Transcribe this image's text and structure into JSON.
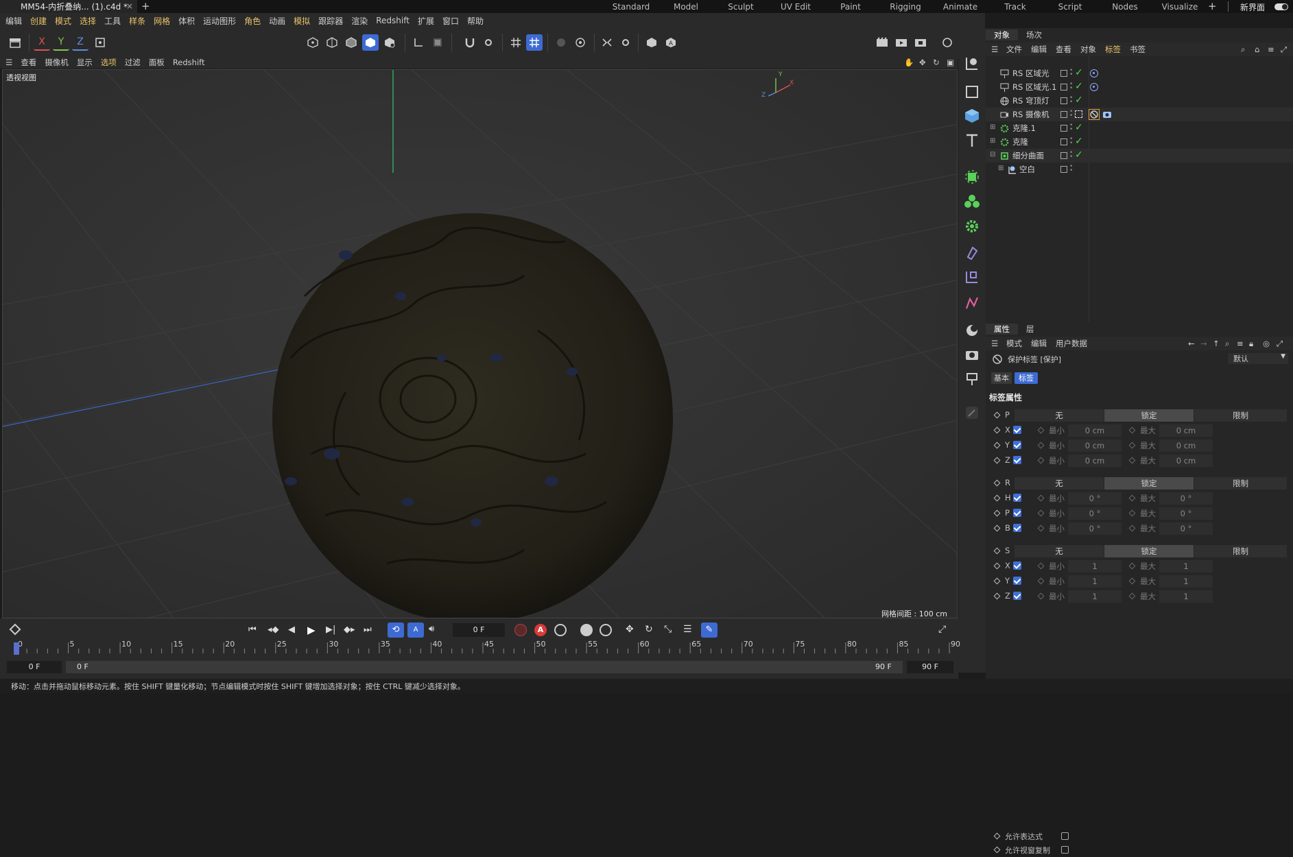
{
  "tab": {
    "title": "MM54-内折叠纳... (1).c4d *"
  },
  "layouts": [
    "Standard",
    "Model",
    "Sculpt",
    "UV Edit",
    "Paint",
    "Rigging",
    "Animate",
    "Track",
    "Script",
    "Nodes",
    "Visualize"
  ],
  "new_interface": "新界面",
  "menu": [
    {
      "label": "编辑",
      "hl": false
    },
    {
      "label": "创建",
      "hl": true
    },
    {
      "label": "模式",
      "hl": true
    },
    {
      "label": "选择",
      "hl": true
    },
    {
      "label": "工具",
      "hl": false
    },
    {
      "label": "样条",
      "hl": true
    },
    {
      "label": "网格",
      "hl": true
    },
    {
      "label": "体积",
      "hl": false
    },
    {
      "label": "运动图形",
      "hl": false
    },
    {
      "label": "角色",
      "hl": true
    },
    {
      "label": "动画",
      "hl": false
    },
    {
      "label": "模拟",
      "hl": true
    },
    {
      "label": "跟踪器",
      "hl": false
    },
    {
      "label": "渲染",
      "hl": false
    },
    {
      "label": "Redshift",
      "hl": false
    },
    {
      "label": "扩展",
      "hl": false
    },
    {
      "label": "窗口",
      "hl": false
    },
    {
      "label": "帮助",
      "hl": false
    }
  ],
  "toolbar": {
    "x": "X",
    "y": "Y",
    "z": "Z"
  },
  "viewport": {
    "menu": [
      {
        "label": "查看",
        "hl": false
      },
      {
        "label": "摄像机",
        "hl": false
      },
      {
        "label": "显示",
        "hl": false
      },
      {
        "label": "选项",
        "hl": true
      },
      {
        "label": "过滤",
        "hl": false
      },
      {
        "label": "面板",
        "hl": false
      },
      {
        "label": "Redshift",
        "hl": false
      }
    ],
    "label": "透视视图",
    "grid_spacing": "网格间距 : 100 cm",
    "axis": {
      "x": "X",
      "y": "Y",
      "z": "Z"
    }
  },
  "objects": {
    "tabs": [
      "对象",
      "场次"
    ],
    "menu": [
      {
        "label": "文件",
        "hl": false
      },
      {
        "label": "编辑",
        "hl": false
      },
      {
        "label": "查看",
        "hl": false
      },
      {
        "label": "对象",
        "hl": false
      },
      {
        "label": "标签",
        "hl": true
      },
      {
        "label": "书签",
        "hl": false
      }
    ],
    "rows": [
      {
        "name": "RS 区域光",
        "icon": "area-light-icon",
        "check": true,
        "tag": "target"
      },
      {
        "name": "RS 区域光.1",
        "icon": "area-light-icon",
        "check": true,
        "tag": "target"
      },
      {
        "name": "RS 穹顶灯",
        "icon": "dome-light-icon",
        "check": true,
        "tag": ""
      },
      {
        "name": "RS 摄像机",
        "icon": "camera-icon",
        "check": false,
        "tag": "protect-camera"
      },
      {
        "name": "克隆.1",
        "icon": "cloner-icon",
        "check": true,
        "tag": ""
      },
      {
        "name": "克隆",
        "icon": "cloner-icon",
        "check": true,
        "tag": ""
      },
      {
        "name": "细分曲面",
        "icon": "subdivision-icon",
        "check": true,
        "tag": ""
      },
      {
        "name": "空白",
        "icon": "null-icon",
        "check": false,
        "tag": ""
      }
    ]
  },
  "attributes": {
    "tabs": [
      "属性",
      "层"
    ],
    "menu": [
      "模式",
      "编辑",
      "用户数据"
    ],
    "tag_title": "保护标签 [保护]",
    "preset": "默认",
    "subtabs": [
      "基本",
      "标签"
    ],
    "section": "标签属性",
    "groups": [
      {
        "key": "P",
        "none": "无",
        "lock": "锁定",
        "limit": "限制",
        "axes": [
          {
            "a": "X",
            "min": "最小",
            "minv": "0 cm",
            "max": "最大",
            "maxv": "0 cm"
          },
          {
            "a": "Y",
            "min": "最小",
            "minv": "0 cm",
            "max": "最大",
            "maxv": "0 cm"
          },
          {
            "a": "Z",
            "min": "最小",
            "minv": "0 cm",
            "max": "最大",
            "maxv": "0 cm"
          }
        ]
      },
      {
        "key": "R",
        "none": "无",
        "lock": "锁定",
        "limit": "限制",
        "axes": [
          {
            "a": "H",
            "min": "最小",
            "minv": "0 °",
            "max": "最大",
            "maxv": "0 °"
          },
          {
            "a": "P",
            "min": "最小",
            "minv": "0 °",
            "max": "最大",
            "maxv": "0 °"
          },
          {
            "a": "B",
            "min": "最小",
            "minv": "0 °",
            "max": "最大",
            "maxv": "0 °"
          }
        ]
      },
      {
        "key": "S",
        "none": "无",
        "lock": "锁定",
        "limit": "限制",
        "axes": [
          {
            "a": "X",
            "min": "最小",
            "minv": "1",
            "max": "最大",
            "maxv": "1"
          },
          {
            "a": "Y",
            "min": "最小",
            "minv": "1",
            "max": "最大",
            "maxv": "1"
          },
          {
            "a": "Z",
            "min": "最小",
            "minv": "1",
            "max": "最大",
            "maxv": "1"
          }
        ]
      }
    ],
    "allow_expression": "允许表达式",
    "allow_viewport_copy": "允许视窗复制"
  },
  "timeline": {
    "current_frame": "0 F",
    "ticks": [
      "0",
      "5",
      "10",
      "15",
      "20",
      "25",
      "30",
      "35",
      "40",
      "45",
      "50",
      "55",
      "60",
      "65",
      "70",
      "75",
      "80",
      "85",
      "90"
    ],
    "start_a": "0 F",
    "start_b": "0 F",
    "end_a": "90 F",
    "end_b": "90 F"
  },
  "status": "移动：点击并拖动鼠标移动元素。按住 SHIFT 键量化移动；节点编辑模式时按住 SHIFT 键增加选择对象；按住 CTRL 键减少选择对象。"
}
